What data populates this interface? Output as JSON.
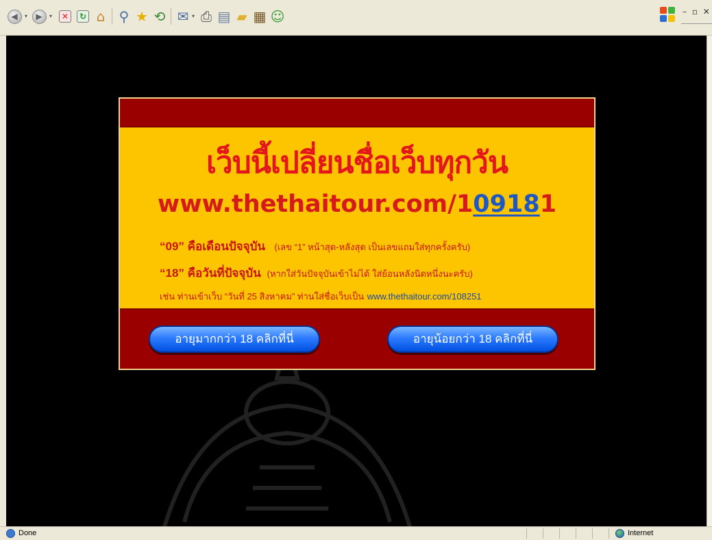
{
  "toolbar": {
    "buttons": [
      "back-icon",
      "forward-icon",
      "stop-icon",
      "refresh-icon",
      "home-icon",
      "search-icon",
      "favorites-icon",
      "history-icon",
      "mail-icon",
      "print-icon",
      "edit-icon",
      "folder-icon",
      "research-icon",
      "messenger-icon"
    ],
    "window_controls": "– ▫ ✕"
  },
  "banner": {
    "headline": "เว็บนี้เปลี่ยนชื่อเว็บทุกวัน",
    "url_prefix": "www.thethaitour.com/1",
    "url_month": "09",
    "url_day": "18",
    "url_suffix": "1",
    "line1_bold": "“09” คือเดือนปัจจุบัน",
    "line1_note": "(เลข “1” หน้าสุด-หลังสุด เป็นเลขแถมใส่ทุกครั้งครับ)",
    "line2_bold": "“18” คือวันที่ปัจจุบัน",
    "line2_note": "(หากใส่วันปัจจุบันเข้าไม่ได้ ใส่ย้อนหลังนิดหนึ่งนะครับ)",
    "example_text": "เช่น ท่านเข้าเว็บ “วันที่ 25 สิงหาคม” ท่านใส่ชื่อเว็บเป็น",
    "example_url": "www.thethaitour.com/108251",
    "button_over18": "อายุมากกว่า 18 คลิกที่นี่",
    "button_under18": "อายุน้อยกว่า 18 คลิกที่นี่"
  },
  "statusbar": {
    "status": "Done",
    "zone": "Internet"
  },
  "colors": {
    "banner_red": "#9b0000",
    "banner_yellow": "#fdc500",
    "headline_red": "#e3161b",
    "link_blue": "#1d58c4",
    "button_blue": "#2d7bff"
  }
}
